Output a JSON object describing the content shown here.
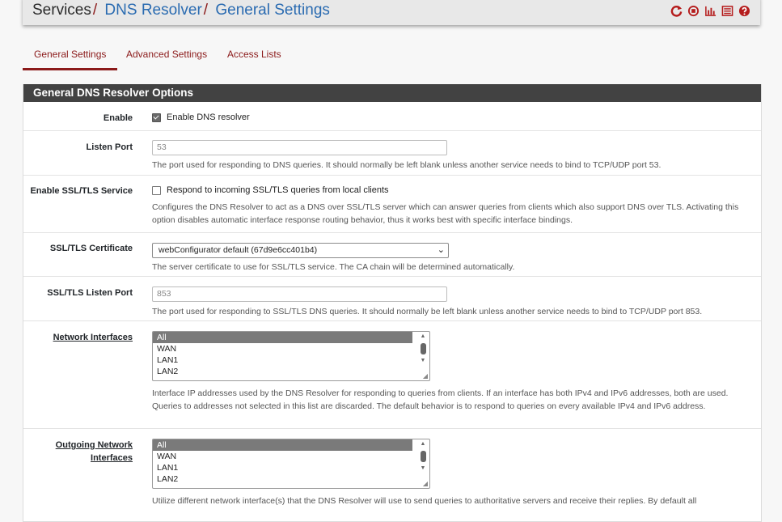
{
  "breadcrumb": {
    "root": "Services",
    "sep1": "/",
    "section": "DNS Resolver",
    "sep2": "/",
    "page": "General Settings"
  },
  "header_icons": [
    "reload-icon",
    "stop-icon",
    "chart-icon",
    "log-icon",
    "help-icon"
  ],
  "tabs": [
    {
      "label": "General Settings",
      "active": true
    },
    {
      "label": "Advanced Settings",
      "active": false
    },
    {
      "label": "Access Lists",
      "active": false
    }
  ],
  "panel": {
    "title": "General DNS Resolver Options"
  },
  "fields": {
    "enable": {
      "label": "Enable",
      "checkbox_label": "Enable DNS resolver",
      "checked": true
    },
    "listen_port": {
      "label": "Listen Port",
      "placeholder": "53",
      "help": "The port used for responding to DNS queries. It should normally be left blank unless another service needs to bind to TCP/UDP port 53."
    },
    "ssl_tls_service": {
      "label": "Enable SSL/TLS Service",
      "checkbox_label": "Respond to incoming SSL/TLS queries from local clients",
      "checked": false,
      "help": "Configures the DNS Resolver to act as a DNS over SSL/TLS server which can answer queries from clients which also support DNS over TLS. Activating this option disables automatic interface response routing behavior, thus it works best with specific interface bindings."
    },
    "ssl_tls_certificate": {
      "label": "SSL/TLS Certificate",
      "value": "webConfigurator default (67d9e6cc401b4)",
      "help": "The server certificate to use for SSL/TLS service. The CA chain will be determined automatically."
    },
    "ssl_tls_listen_port": {
      "label": "SSL/TLS Listen Port",
      "placeholder": "853",
      "help": "The port used for responding to SSL/TLS DNS queries. It should normally be left blank unless another service needs to bind to TCP/UDP port 853."
    },
    "network_interfaces": {
      "label": "Network Interfaces",
      "options": [
        "All",
        "WAN",
        "LAN1",
        "LAN2"
      ],
      "selected": "All",
      "help": "Interface IP addresses used by the DNS Resolver for responding to queries from clients. If an interface has both IPv4 and IPv6 addresses, both are used. Queries to addresses not selected in this list are discarded. The default behavior is to respond to queries on every available IPv4 and IPv6 address."
    },
    "outgoing_interfaces": {
      "label": "Outgoing Network Interfaces",
      "options": [
        "All",
        "WAN",
        "LAN1",
        "LAN2"
      ],
      "selected": "All",
      "help": "Utilize different network interface(s) that the DNS Resolver will use to send queries to authoritative servers and receive their replies. By default all"
    }
  },
  "colors": {
    "accent": "#8b1a1a",
    "link": "#2a6bb1",
    "panel_header": "#424242"
  }
}
